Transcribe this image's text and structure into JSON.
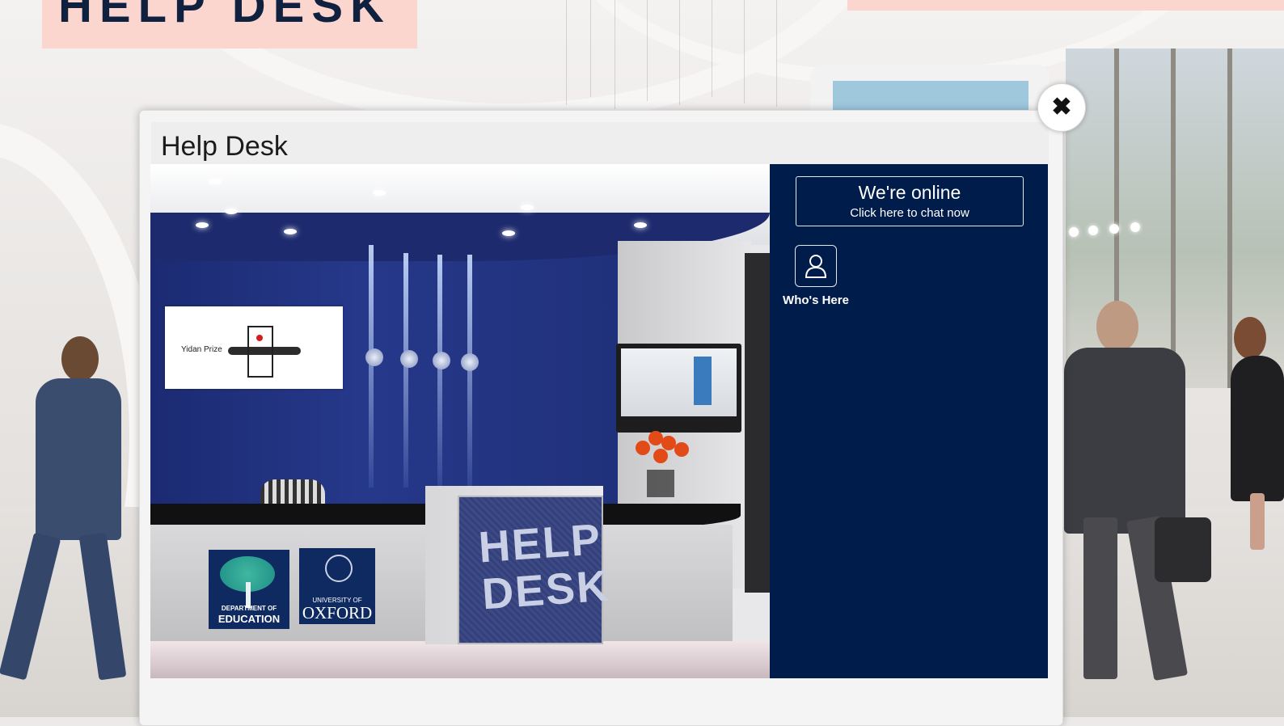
{
  "banner": {
    "title": "HELP DESK"
  },
  "modal": {
    "title": "Help Desk",
    "close_icon": "close-icon",
    "close_glyph": "✖"
  },
  "scene": {
    "poster_text": "Yidan Prize",
    "desk_sign": "HELP DESK",
    "logo_education_top": "DEPARTMENT OF",
    "logo_education_bottom": "EDUCATION",
    "logo_oxford_top": "UNIVERSITY OF",
    "logo_oxford_bottom": "OXFORD"
  },
  "chat": {
    "status": "We're online",
    "cta": "Click here to chat now",
    "whos_here_label": "Who's Here",
    "whos_here_icon": "person-icon"
  },
  "colors": {
    "panel_navy": "#001c4b",
    "banner_pink": "#fbd6cf",
    "banner_text": "#10213f"
  }
}
